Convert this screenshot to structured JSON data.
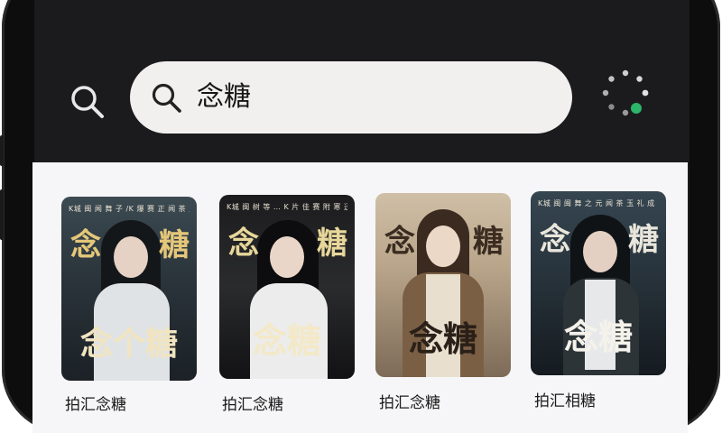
{
  "search": {
    "query": "念糖"
  },
  "icons": {
    "search_button": "search-icon",
    "input_icon": "search-icon",
    "loading": "loading-spinner-icon"
  },
  "colors": {
    "accent_green": "#2db36a",
    "pill_bg": "#f2f0ef",
    "content_bg": "#f6f6f8"
  },
  "results": [
    {
      "cover_top": "K城 闽 闻 舞 子 /K 爆 赛 正   闻 茶 玉 扎 成",
      "cover_left": "念",
      "cover_right": "糖",
      "cover_big": "念个糖",
      "caption": "拍汇念糖"
    },
    {
      "cover_top": "K城 闽 树 等 … K 片 佳 赛   附 寒 迅 孔 成",
      "cover_left": "念",
      "cover_right": "糖",
      "cover_big": "念糖",
      "caption": "拍汇念糖"
    },
    {
      "cover_top": "",
      "cover_left": "念",
      "cover_right": "糖",
      "cover_big": "念糖",
      "caption": "拍汇念糖"
    },
    {
      "cover_top": "K城 闽 闽 舞 之 元 闻 茶 玉 礼 成",
      "cover_left": "念",
      "cover_right": "糖",
      "cover_big": "念糖",
      "caption": "拍汇相糖"
    }
  ]
}
